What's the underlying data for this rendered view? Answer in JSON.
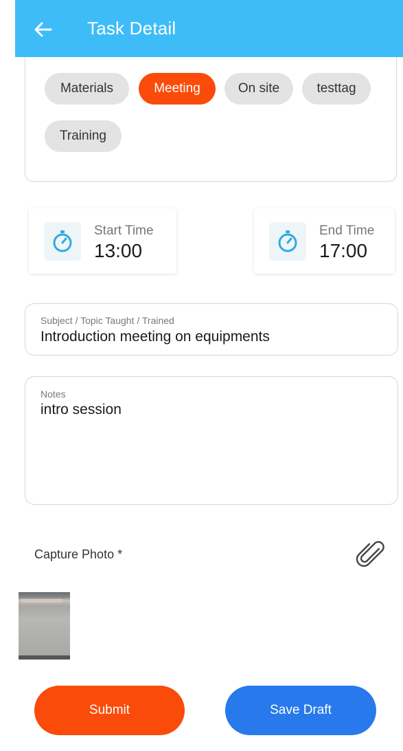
{
  "appbar": {
    "title": "Task Detail"
  },
  "tags": [
    {
      "label": "Materials",
      "selected": false
    },
    {
      "label": "Meeting",
      "selected": true
    },
    {
      "label": "On site",
      "selected": false
    },
    {
      "label": "testtag",
      "selected": false
    },
    {
      "label": "Training",
      "selected": false
    }
  ],
  "start_time": {
    "label": "Start Time",
    "value": "13:00"
  },
  "end_time": {
    "label": "End Time",
    "value": "17:00"
  },
  "subject": {
    "label": "Subject / Topic Taught / Trained",
    "value": "Introduction meeting on equipments"
  },
  "notes": {
    "label": "Notes",
    "value": "intro session"
  },
  "capture": {
    "label": "Capture Photo *"
  },
  "buttons": {
    "submit": "Submit",
    "save_draft": "Save Draft"
  },
  "colors": {
    "appbar": "#3ebcf8",
    "accent_orange": "#fa4b0a",
    "accent_blue": "#2879ec",
    "timer_icon": "#2fa9e0"
  }
}
